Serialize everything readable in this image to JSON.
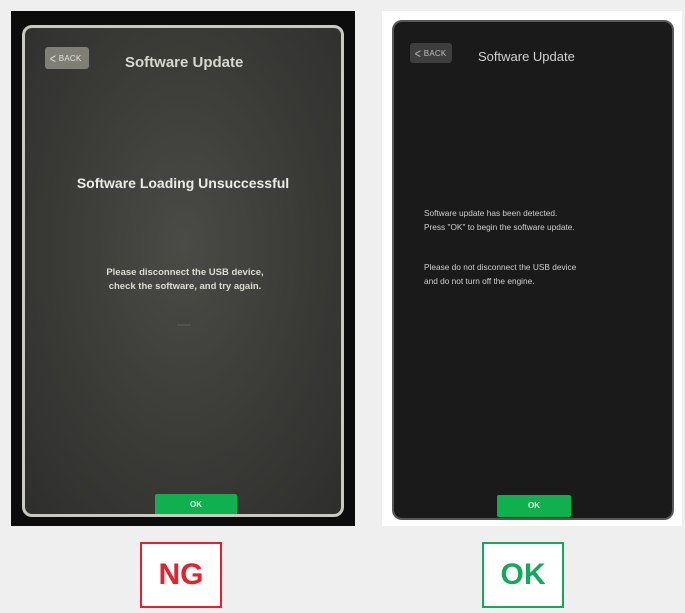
{
  "ng_panel": {
    "back_label": "BACK",
    "title": "Software Update",
    "heading": "Software Loading Unsuccessful",
    "message": "Please disconnect the USB device,\ncheck the software, and try again.",
    "ok_label": "OK",
    "verdict": "NG"
  },
  "ok_panel": {
    "back_label": "BACK",
    "title": "Software Update",
    "message1": "Software update has been detected.\nPress \"OK\" to begin the software update.",
    "message2": "Please do not disconnect the USB device\nand do not turn off the engine.",
    "ok_label": "OK",
    "verdict": "OK"
  },
  "colors": {
    "ng": "#e8202a",
    "ok": "#14a85a",
    "button_green": "#0fb04d"
  },
  "icons": {
    "back": "chevron-left-icon"
  }
}
